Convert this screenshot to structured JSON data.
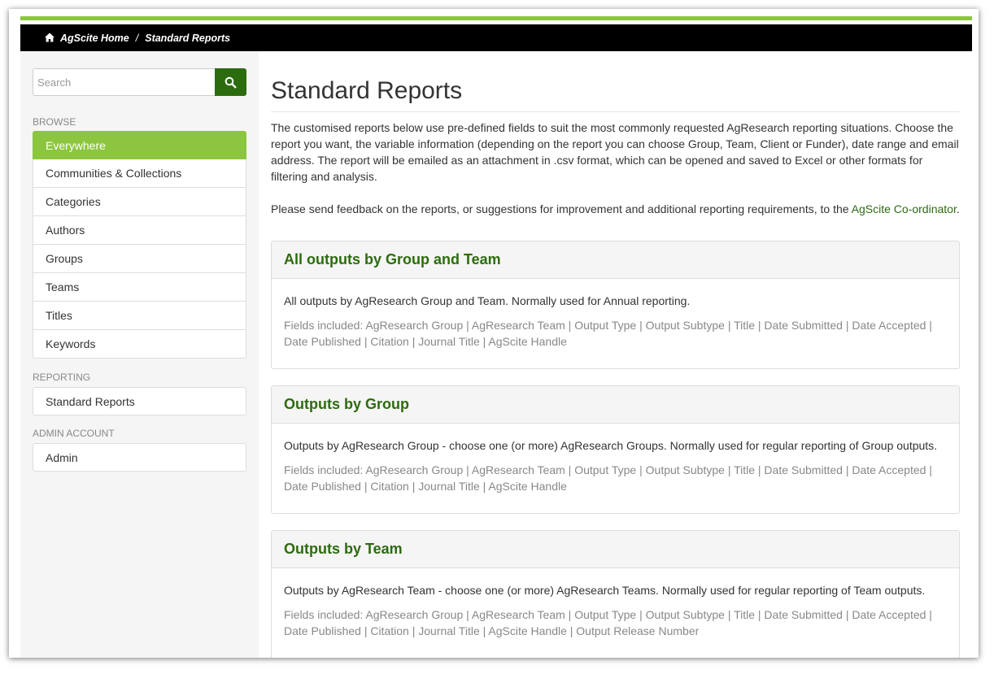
{
  "breadcrumb": {
    "home": "AgScite Home",
    "separator": "/",
    "current": "Standard Reports"
  },
  "search": {
    "placeholder": "Search",
    "button_icon": "search-icon"
  },
  "sidebar": {
    "browse_label": "BROWSE",
    "browse_items": [
      {
        "label": "Everywhere",
        "active": true
      },
      {
        "label": "Communities & Collections"
      },
      {
        "label": "Categories"
      },
      {
        "label": "Authors"
      },
      {
        "label": "Groups"
      },
      {
        "label": "Teams"
      },
      {
        "label": "Titles"
      },
      {
        "label": "Keywords"
      }
    ],
    "reporting_label": "REPORTING",
    "reporting_items": [
      {
        "label": "Standard Reports"
      }
    ],
    "admin_label": "ADMIN ACCOUNT",
    "admin_items": [
      {
        "label": "Admin"
      }
    ]
  },
  "main": {
    "title": "Standard Reports",
    "intro": "The customised reports below use pre-defined fields to suit the most commonly requested AgResearch reporting situations. Choose the report you want, the variable information (depending on the report you can choose Group, Team, Client or Funder), date range and email address. The report will be emailed as an attachment in .csv format, which can be opened and saved to Excel or other formats for filtering and analysis.",
    "feedback_text": "Please send feedback on the reports, or suggestions for improvement and additional reporting requirements, to the ",
    "feedback_link": "AgScite Co-ordinator",
    "feedback_end": ".",
    "reports": [
      {
        "title": "All outputs by Group and Team",
        "description": "All outputs by AgResearch Group and Team. Normally used for Annual reporting.",
        "fields": "Fields included: AgResearch Group | AgResearch Team | Output Type | Output Subtype | Title | Date Submitted | Date Accepted | Date Published | Citation | Journal Title | AgScite Handle"
      },
      {
        "title": "Outputs by Group",
        "description": "Outputs by AgResearch Group - choose one (or more) AgResearch Groups. Normally used for regular reporting of Group outputs.",
        "fields": "Fields included: AgResearch Group | AgResearch Team | Output Type | Output Subtype | Title | Date Submitted | Date Accepted | Date Published | Citation | Journal Title | AgScite Handle"
      },
      {
        "title": "Outputs by Team",
        "description": "Outputs by AgResearch Team - choose one (or more) AgResearch Teams. Normally used for regular reporting of Team outputs.",
        "fields": "Fields included: AgResearch Group | AgResearch Team | Output Type | Output Subtype | Title | Date Submitted | Date Accepted | Date Published | Citation | Journal Title | AgScite Handle | Output Release Number"
      }
    ]
  },
  "colors": {
    "accent_green": "#8cc63f",
    "dark_green": "#2d6b0f",
    "topbar": "#000000"
  }
}
